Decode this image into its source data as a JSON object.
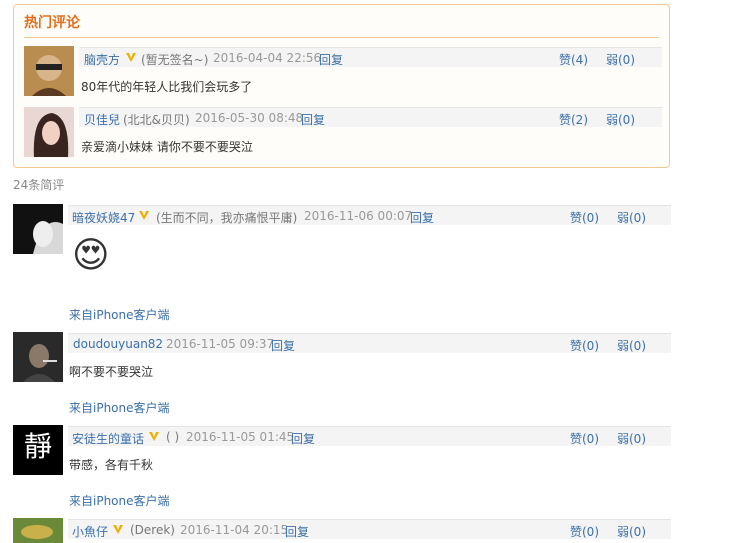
{
  "hot": {
    "title": "热门评论",
    "comments": [
      {
        "name": "脑壳方",
        "sig": "(暂无签名~)",
        "time": "2016-04-04 22:56",
        "reply": "回复",
        "like": "赞(4)",
        "weak": "弱(0)",
        "text": "80年代的年轻人比我们会玩多了"
      },
      {
        "name": "贝佳兒",
        "sig": "(北北&贝贝)",
        "time": "2016-05-30 08:48",
        "reply": "回复",
        "like": "赞(2)",
        "weak": "弱(0)",
        "text": "亲爱滴小妹妹 请你不要不要哭泣"
      }
    ]
  },
  "count_label": "24条简评",
  "comments": [
    {
      "name": "暗夜妖娆47",
      "sig": "(生而不同，我亦痛恨平庸)",
      "time": "2016-11-06 00:07",
      "reply": "回复",
      "like": "赞(0)",
      "weak": "弱(0)",
      "text": "",
      "emoji": "😍",
      "source": "来自iPhone客户端"
    },
    {
      "name": "doudouyuan82",
      "sig": "",
      "time": "2016-11-05 09:37",
      "reply": "回复",
      "like": "赞(0)",
      "weak": "弱(0)",
      "text": "啊不要不要哭泣",
      "source": "来自iPhone客户端"
    },
    {
      "name": "安徒生的童话",
      "sig": "( )",
      "time": "2016-11-05 01:45",
      "reply": "回复",
      "like": "赞(0)",
      "weak": "弱(0)",
      "text": "带感，各有千秋",
      "source": "来自iPhone客户端",
      "avatar_char": "靜"
    },
    {
      "name": "小魚仔",
      "sig": "(Derek)",
      "time": "2016-11-04 20:15",
      "reply": "回复",
      "like": "赞(0)",
      "weak": "弱(0)",
      "text": "",
      "source": ""
    }
  ],
  "colors": {
    "accent": "#e0701e",
    "link": "#3c6fa8",
    "vip": "#f0b000"
  }
}
